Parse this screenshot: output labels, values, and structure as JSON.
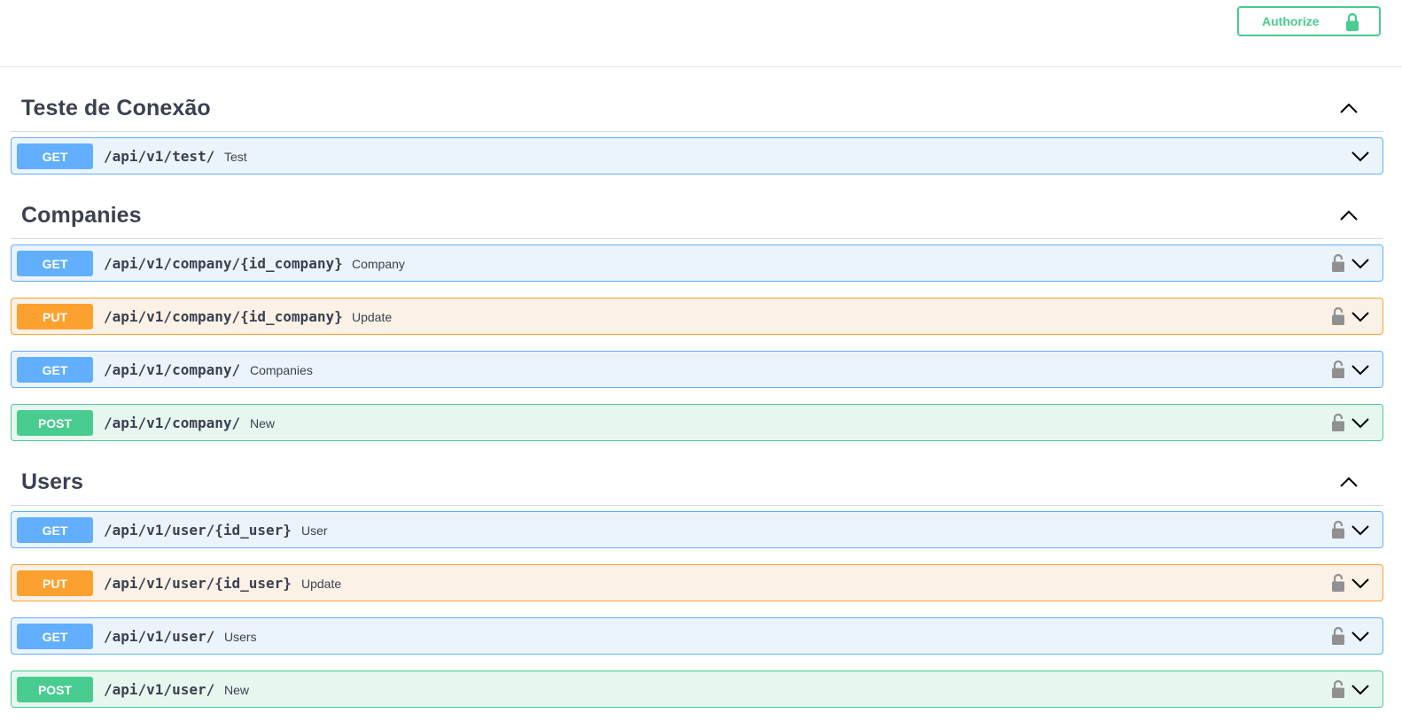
{
  "header": {
    "authorize_label": "Authorize",
    "authorize_icon": "lock-icon"
  },
  "colors": {
    "get": "#61affe",
    "put": "#fca130",
    "post": "#49cc90",
    "text": "#3b4151"
  },
  "sections": [
    {
      "title": "Teste de Conexão",
      "operations": [
        {
          "method": "GET",
          "path": "/api/v1/test/",
          "summary": "Test",
          "locked": false
        }
      ]
    },
    {
      "title": "Companies",
      "operations": [
        {
          "method": "GET",
          "path": "/api/v1/company/{id_company}",
          "summary": "Company",
          "locked": true
        },
        {
          "method": "PUT",
          "path": "/api/v1/company/{id_company}",
          "summary": "Update",
          "locked": true
        },
        {
          "method": "GET",
          "path": "/api/v1/company/",
          "summary": "Companies",
          "locked": true
        },
        {
          "method": "POST",
          "path": "/api/v1/company/",
          "summary": "New",
          "locked": true
        }
      ]
    },
    {
      "title": "Users",
      "operations": [
        {
          "method": "GET",
          "path": "/api/v1/user/{id_user}",
          "summary": "User",
          "locked": true
        },
        {
          "method": "PUT",
          "path": "/api/v1/user/{id_user}",
          "summary": "Update",
          "locked": true
        },
        {
          "method": "GET",
          "path": "/api/v1/user/",
          "summary": "Users",
          "locked": true
        },
        {
          "method": "POST",
          "path": "/api/v1/user/",
          "summary": "New",
          "locked": true
        }
      ]
    }
  ]
}
